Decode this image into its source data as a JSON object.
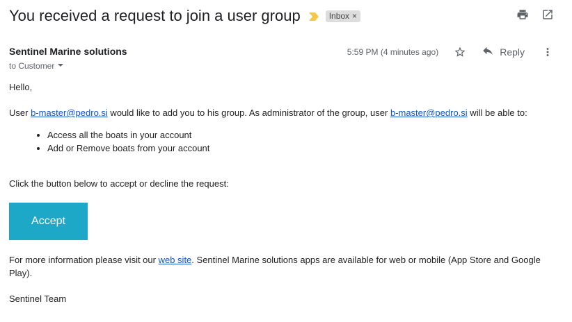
{
  "email": {
    "subject": "You received a request to join a user group",
    "label": "Inbox",
    "label_close": "×",
    "sender": "Sentinel Marine solutions",
    "recipient_line": "to Customer",
    "time": "5:59 PM (4 minutes ago)",
    "reply_label": "Reply",
    "body": {
      "greeting": "Hello,",
      "intro_pre": "User ",
      "user_link_1": "b-master@pedro.si",
      "intro_mid": " would like to add you to his group. As administrator of the group, user ",
      "user_link_2": "b-master@pedro.si",
      "intro_post": " will be able to:",
      "bullets": [
        "Access all the boats in your account",
        "Add or Remove boats from your account"
      ],
      "instruction": "Click the button below to accept or decline the request:",
      "accept_label": "Accept",
      "info_pre": "For more information please visit our ",
      "info_link": "web site",
      "info_post": ". Sentinel Marine solutions apps are available for web or mobile (App Store and Google Play).",
      "signature": "Sentinel Team"
    }
  },
  "icons": {
    "importance": "importance-marker-icon",
    "print": "print-icon",
    "open_new_window": "open-in-new-window-icon",
    "star": "star-icon",
    "reply": "reply-icon",
    "more": "more-vert-icon",
    "dropdown": "caret-down-icon"
  },
  "colors": {
    "accept_button": "#1ea8c8",
    "link": "#1155cc",
    "importance": "#f2c94c",
    "label_chip": "#dddddd"
  }
}
